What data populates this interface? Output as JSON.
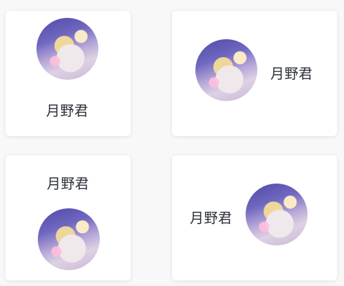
{
  "cards": [
    {
      "name": "月野君",
      "layout": "avatar-top"
    },
    {
      "name": "月野君",
      "layout": "avatar-left"
    },
    {
      "name": "月野君",
      "layout": "avatar-bottom"
    },
    {
      "name": "月野君",
      "layout": "avatar-right"
    }
  ]
}
